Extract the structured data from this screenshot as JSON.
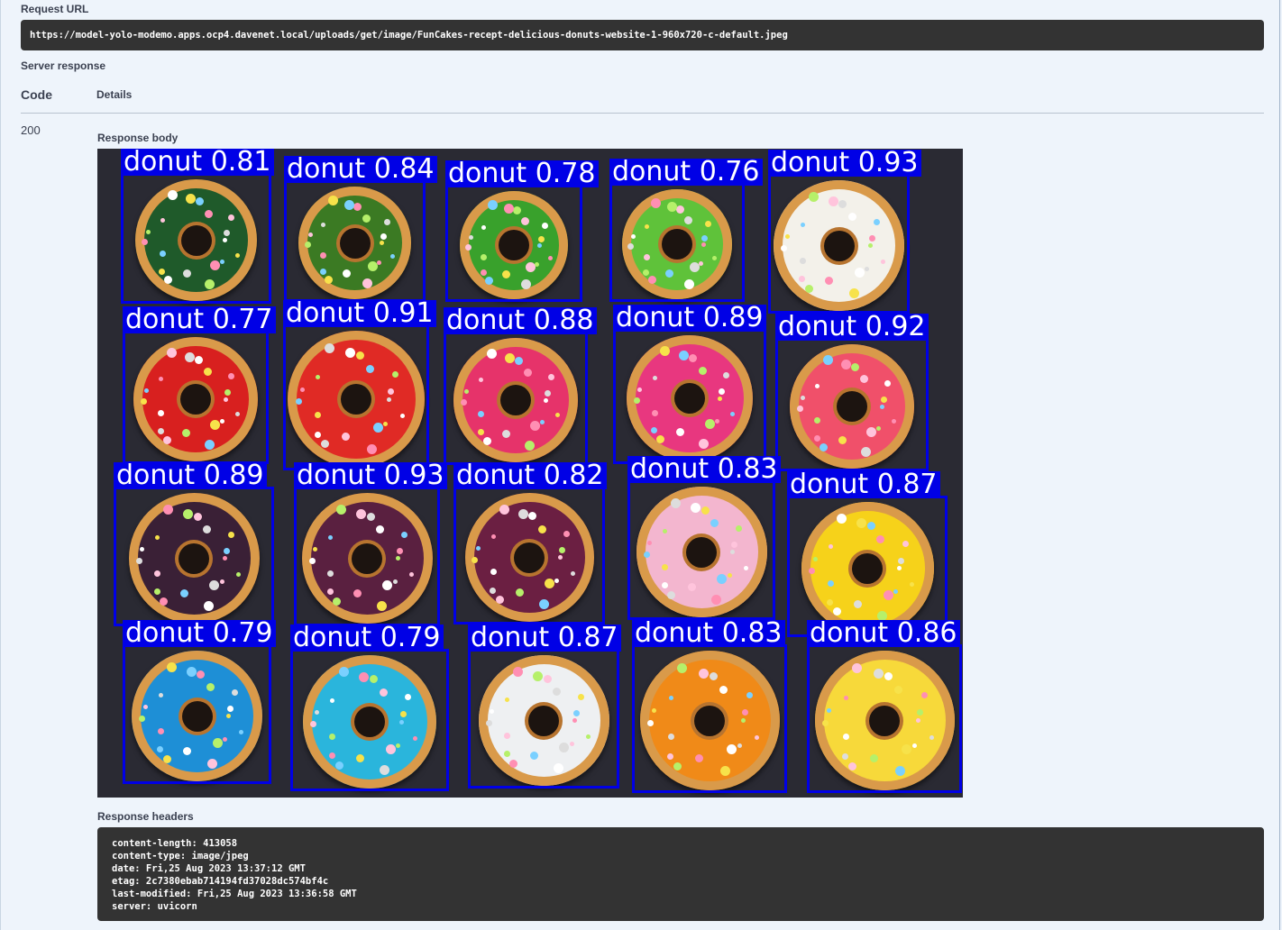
{
  "request_url_label": "Request URL",
  "request_url": "https://model-yolo-modemo.apps.ocp4.davenet.local/uploads/get/image/FunCakes-recept-delicious-donuts-website-1-960x720-c-default.jpeg",
  "server_response_label": "Server response",
  "table_headers": {
    "code": "Code",
    "details": "Details"
  },
  "response_code": "200",
  "response_body_label": "Response body",
  "response_headers_label": "Response headers",
  "response_headers": [
    "content-length: 413058",
    "content-type: image/jpeg",
    "date: Fri,25 Aug 2023 13:37:12 GMT",
    "etag: 2c7380ebab714194fd37028dc574bf4c",
    "last-modified: Fri,25 Aug 2023 13:36:58 GMT",
    "server: uvicorn"
  ],
  "detections": [
    {
      "label": "donut 0.81",
      "color": "#1f5a2a"
    },
    {
      "label": "donut 0.84",
      "color": "#3b7a23"
    },
    {
      "label": "donut 0.78",
      "color": "#39a12c"
    },
    {
      "label": "donut 0.76",
      "color": "#5fc23a"
    },
    {
      "label": "donut 0.93",
      "color": "#f3f1ea"
    },
    {
      "label": "donut 0.77",
      "color": "#d8201f"
    },
    {
      "label": "donut 0.91",
      "color": "#e02a25"
    },
    {
      "label": "donut 0.88",
      "color": "#e6336a"
    },
    {
      "label": "donut 0.89",
      "color": "#e8377f"
    },
    {
      "label": "donut 0.92",
      "color": "#f0506a"
    },
    {
      "label": "donut 0.89",
      "color": "#3a2036"
    },
    {
      "label": "donut 0.93",
      "color": "#5a2040"
    },
    {
      "label": "donut 0.82",
      "color": "#6b1f42"
    },
    {
      "label": "donut 0.83",
      "color": "#f3b6cf"
    },
    {
      "label": "donut 0.87",
      "color": "#f6d21a"
    },
    {
      "label": "donut 0.79",
      "color": "#1e8fd6"
    },
    {
      "label": "donut 0.79",
      "color": "#2ab5dc"
    },
    {
      "label": "donut 0.87",
      "color": "#eef0f2"
    },
    {
      "label": "donut 0.83",
      "color": "#f08a18"
    },
    {
      "label": "donut 0.86",
      "color": "#f7d93a"
    }
  ]
}
